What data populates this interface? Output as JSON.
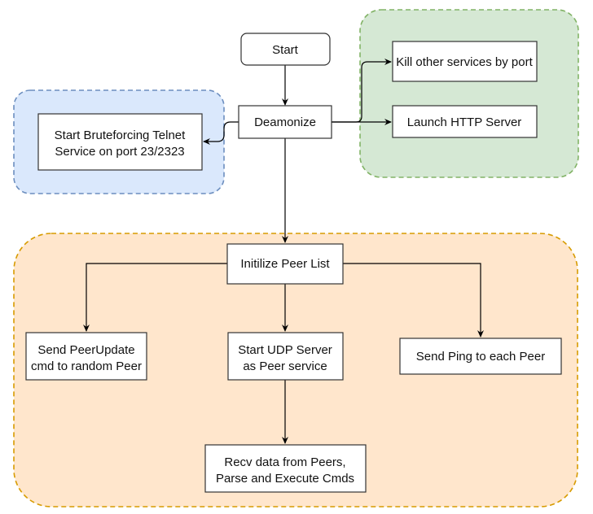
{
  "diagram": {
    "groups": {
      "telnet": {
        "fill": "#dae8fc",
        "stroke": "#6c8ebf"
      },
      "services": {
        "fill": "#d5e8d4",
        "stroke": "#82b366"
      },
      "peer": {
        "fill": "#ffe6cc",
        "stroke": "#d79b00"
      }
    },
    "nodes": {
      "start": {
        "lines": [
          "Start"
        ]
      },
      "deamonize": {
        "lines": [
          "Deamonize"
        ]
      },
      "bruteforce": {
        "lines": [
          "Start Bruteforcing Telnet",
          "Service on port 23/2323"
        ]
      },
      "kill": {
        "lines": [
          "Kill other services by port"
        ]
      },
      "http": {
        "lines": [
          "Launch HTTP Server"
        ]
      },
      "initpeer": {
        "lines": [
          "Initilize Peer List"
        ]
      },
      "peerupdate": {
        "lines": [
          "Send PeerUpdate",
          "cmd to random Peer"
        ]
      },
      "udp": {
        "lines": [
          "Start UDP Server",
          "as Peer service"
        ]
      },
      "ping": {
        "lines": [
          "Send Ping to each Peer"
        ]
      },
      "recv": {
        "lines": [
          "Recv data from Peers,",
          "Parse and Execute Cmds"
        ]
      }
    },
    "edges": [
      {
        "from": "start",
        "to": "deamonize"
      },
      {
        "from": "deamonize",
        "to": "bruteforce"
      },
      {
        "from": "deamonize",
        "to": "kill"
      },
      {
        "from": "deamonize",
        "to": "http"
      },
      {
        "from": "deamonize",
        "to": "initpeer"
      },
      {
        "from": "initpeer",
        "to": "peerupdate"
      },
      {
        "from": "initpeer",
        "to": "udp"
      },
      {
        "from": "initpeer",
        "to": "ping"
      },
      {
        "from": "udp",
        "to": "recv"
      }
    ],
    "line_color": "#000000",
    "box_stroke": "#333333"
  }
}
